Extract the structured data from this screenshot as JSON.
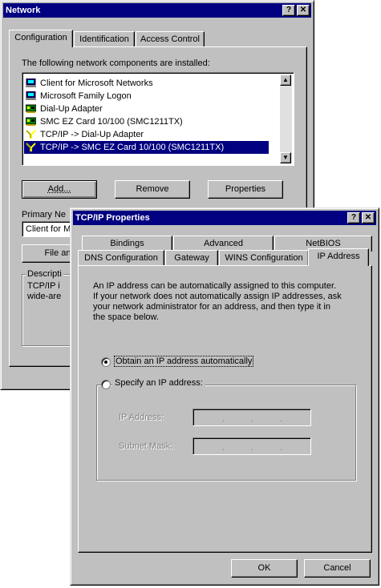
{
  "network": {
    "title": "Network",
    "tabs": [
      "Configuration",
      "Identification",
      "Access Control"
    ],
    "components_label": "The following network components are installed:",
    "components": [
      {
        "label": "Client for Microsoft Networks",
        "icon": "network-client-icon"
      },
      {
        "label": "Microsoft Family Logon",
        "icon": "network-client-icon"
      },
      {
        "label": "Dial-Up Adapter",
        "icon": "adapter-icon"
      },
      {
        "label": "SMC EZ Card 10/100 (SMC1211TX)",
        "icon": "adapter-icon"
      },
      {
        "label": "TCP/IP -> Dial-Up Adapter",
        "icon": "protocol-icon"
      },
      {
        "label": "TCP/IP -> SMC EZ Card 10/100 (SMC1211TX)",
        "icon": "protocol-icon"
      }
    ],
    "selected_index": 5,
    "add_label": "Add...",
    "remove_label": "Remove",
    "properties_label": "Properties",
    "primary_network_label": "Primary Ne",
    "primary_network_value": "Client for M",
    "file_label": "File an",
    "description_label": "Descripti",
    "description_line1": "TCP/IP i",
    "description_line2": "wide-are"
  },
  "tcpip": {
    "title": "TCP/IP Properties",
    "tabs_row1": [
      "Bindings",
      "Advanced",
      "NetBIOS"
    ],
    "tabs_row2": [
      "DNS Configuration",
      "Gateway",
      "WINS Configuration",
      "IP Address"
    ],
    "active_tab": "IP Address",
    "info_lines": [
      "An IP address can be automatically assigned to this computer.",
      "If your network does not automatically assign IP addresses, ask",
      "your network administrator for an address, and then type it in",
      "the space below."
    ],
    "obtain_label": "Obtain an IP address automatically",
    "specify_label": "Specify an IP address:",
    "obtain_selected": true,
    "ip_address_label": "IP Address:",
    "subnet_mask_label": "Subnet Mask:",
    "ok_label": "OK",
    "cancel_label": "Cancel"
  },
  "titlebar_buttons": {
    "help": "?",
    "close": "✕"
  },
  "colors": {
    "titlebar": "#000080",
    "face": "#c0c0c0",
    "selection": "#000080"
  }
}
